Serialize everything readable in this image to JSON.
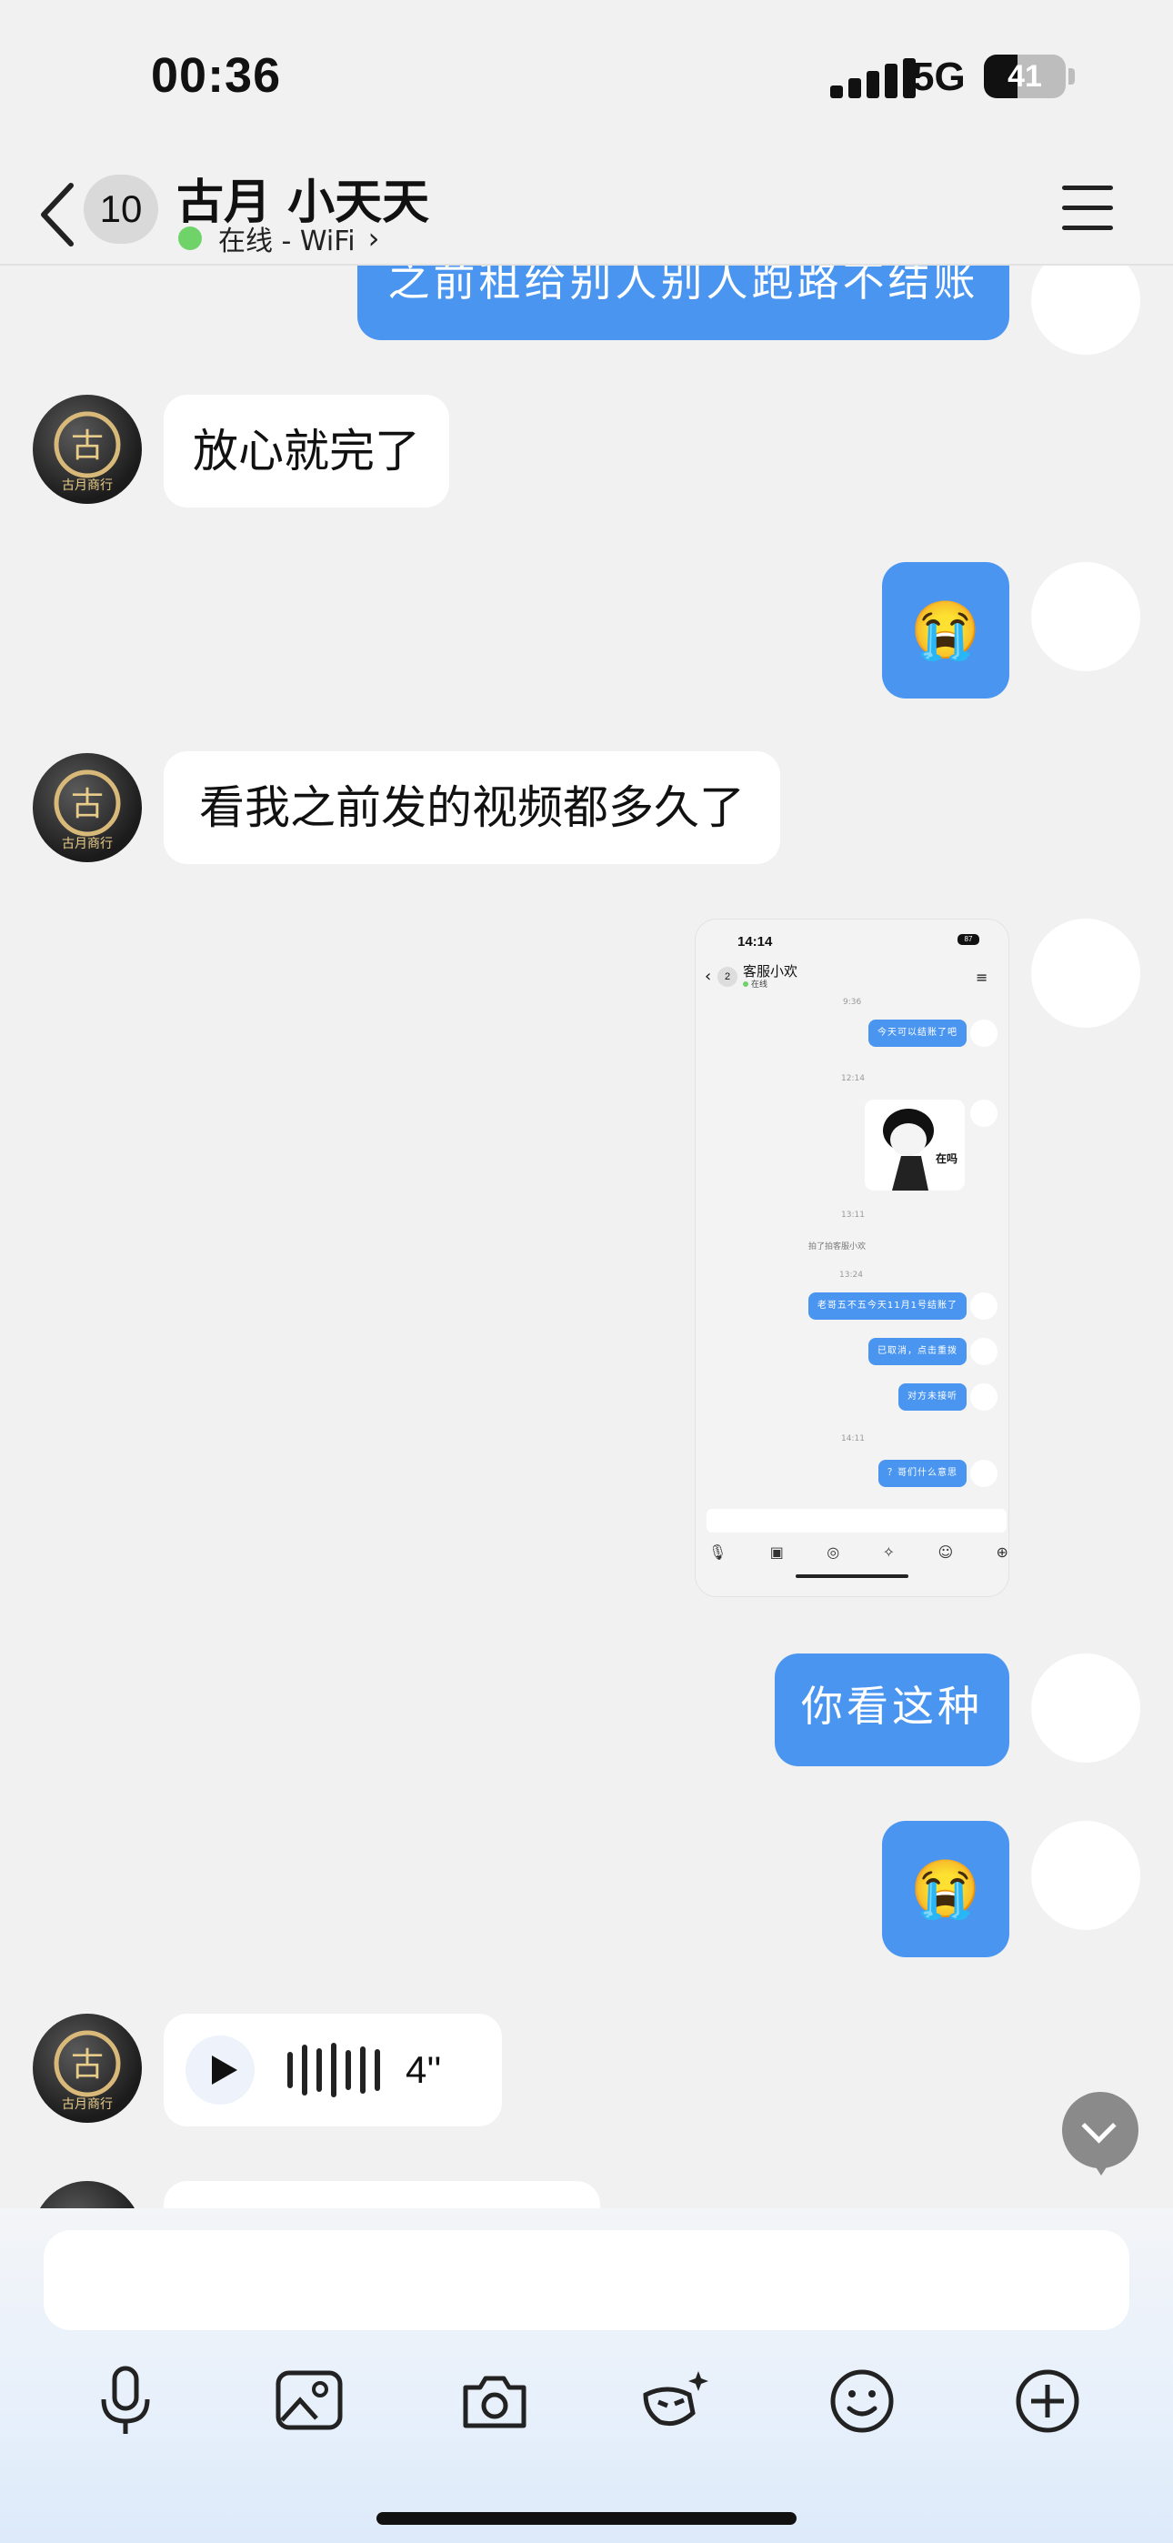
{
  "status_bar": {
    "time": "00:36",
    "network": "5G",
    "battery": "41",
    "battery_level": 0.41
  },
  "header": {
    "unread_count": "10",
    "title": "古月 小天天",
    "presence": "在线 - WiFi"
  },
  "messages": [
    {
      "from": "me",
      "type": "text",
      "text": "之前租给别人别人跑路不结账"
    },
    {
      "from": "peer",
      "type": "text",
      "text": "放心就完了"
    },
    {
      "from": "me",
      "type": "emoji",
      "emoji": "😭"
    },
    {
      "from": "peer",
      "type": "text",
      "text": "看我之前发的视频都多久了"
    },
    {
      "from": "me",
      "type": "image",
      "image": {
        "time": "14:14",
        "status": "⋅ıl 87",
        "battery": "87",
        "badge": "2",
        "title": "客服小欢",
        "presence": "在线",
        "timestamps": [
          "9:36",
          "12:14",
          "13:11",
          "13:24",
          "14:11"
        ],
        "bubbles": [
          "今天可以结账了吧",
          "老哥五不五今天11月1号结账了",
          "已取消，点击重拨",
          "对方未接听",
          "？哥们什么意思"
        ],
        "sticker_text": "在吗",
        "note": "拍了拍客服小欢"
      }
    },
    {
      "from": "me",
      "type": "text",
      "text": "你看这种"
    },
    {
      "from": "me",
      "type": "emoji",
      "emoji": "😭"
    },
    {
      "from": "peer",
      "type": "voice",
      "duration": "4''"
    }
  ],
  "avatar_logo": {
    "glyph": "古",
    "caption": "古月商行"
  },
  "composer": {
    "placeholder": ""
  },
  "toolbar": [
    "microphone-icon",
    "image-icon",
    "camera-icon",
    "magic-mask-icon",
    "smile-icon",
    "plus-circle-icon"
  ],
  "colors": {
    "outgoing": "#4a95f0",
    "incoming": "#ffffff",
    "background": "#f1f1f1",
    "online": "#6fd36a"
  }
}
